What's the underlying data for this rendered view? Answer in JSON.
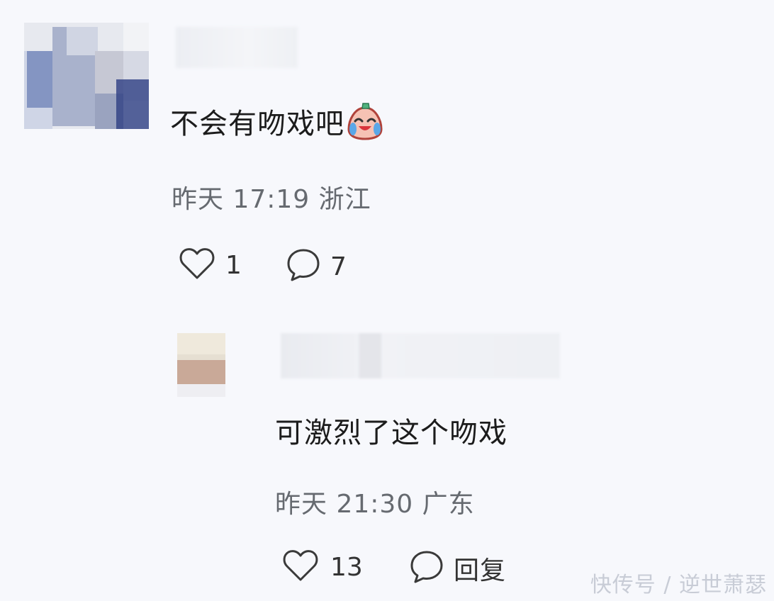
{
  "comment": {
    "text": "不会有吻戏吧",
    "emoji": "laughing-crying-face-emoji",
    "meta": "昨天 17:19 浙江",
    "like_count": "1",
    "reply_count": "7"
  },
  "reply": {
    "text": "可激烈了这个吻戏",
    "meta": "昨天 21:30 广东",
    "like_count": "13",
    "reply_label": "回复"
  },
  "watermark": "快传号 / 逆世萧瑟",
  "colors": {
    "background": "#f7f8fc",
    "text_primary": "#1c1c1c",
    "text_secondary": "#666a70",
    "icon": "#3a3a3a"
  }
}
